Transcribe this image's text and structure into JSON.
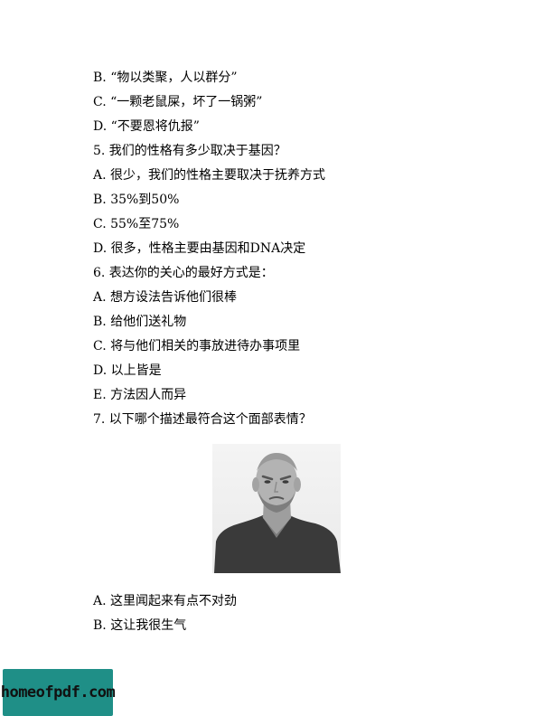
{
  "lines": [
    "B. “物以类聚，人以群分”",
    "C. “一颗老鼠屎，坏了一锅粥”",
    "D. “不要恩将仇报”",
    "5. 我们的性格有多少取决于基因？",
    "A. 很少，我们的性格主要取决于抚养方式",
    "B. 35%到50%",
    "C. 55%至75%",
    "D. 很多，性格主要由基因和DNA决定",
    "6. 表达你的关心的最好方式是：",
    "A. 想方设法告诉他们很棒",
    "B. 给他们送礼物",
    "C. 将与他们相关的事放进待办事项里",
    "D. 以上皆是",
    "E. 方法因人而异",
    "7. 以下哪个描述最符合这个面部表情？"
  ],
  "answers": [
    "A. 这里闻起来有点不对劲",
    "B. 这让我很生气"
  ],
  "logo_text": "homeofpdf.com"
}
